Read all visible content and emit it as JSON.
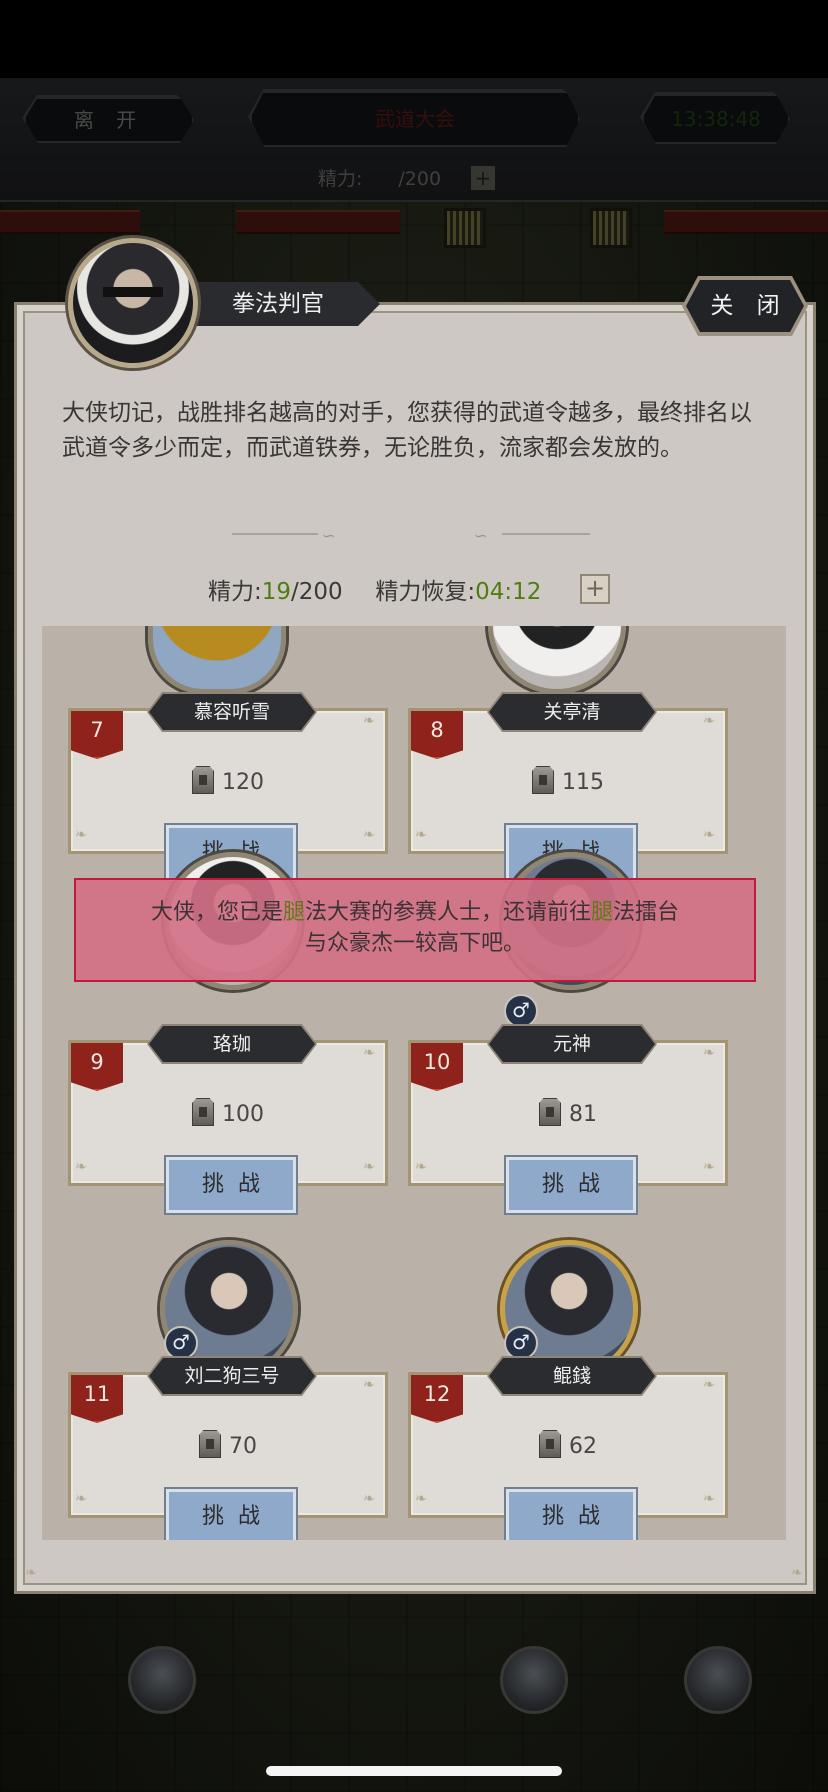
{
  "topbar": {
    "leave_label": "离 开",
    "event_title": "武道大会",
    "timer": "13:38:48",
    "energy_label": "精力:",
    "energy_value": "/200",
    "plus": "+"
  },
  "dialog": {
    "judge_name": "拳法判官",
    "close_label": "关 闭",
    "intro_text": "大侠切记，战胜排名越高的对手，您获得的武道令越多，最终排名以武道令多少而定，而武道铁券，无论胜负，流家都会发放的。",
    "energy_label": "精力:",
    "energy_current": "19",
    "energy_max": "/200",
    "recover_label": "精力恢复:",
    "recover_time": "04:12",
    "plus": "+"
  },
  "opponents": [
    {
      "rank": "7",
      "name": "慕容听雪",
      "score": "120",
      "challenge": "挑战"
    },
    {
      "rank": "8",
      "name": "关亭清",
      "score": "115",
      "challenge": "挑战"
    },
    {
      "rank": "9",
      "name": "珞珈",
      "score": "100",
      "challenge": "挑战"
    },
    {
      "rank": "10",
      "name": "元神",
      "score": "81",
      "challenge": "挑战",
      "gender": "♂"
    },
    {
      "rank": "11",
      "name": "刘二狗三号",
      "score": "70",
      "challenge": "挑战",
      "gender": "♂"
    },
    {
      "rank": "12",
      "name": "鲲錢",
      "score": "62",
      "challenge": "挑战",
      "gender": "♂"
    }
  ],
  "toast": {
    "part1": "大侠，您已是",
    "hl1": "腿",
    "part2": "法大赛的参赛人士，还请前往",
    "hl2": "腿",
    "part3": "法擂台",
    "line2": "与众豪杰一较高下吧。"
  },
  "colors": {
    "accent_green": "#4f7d14",
    "rank_red": "#8f231b",
    "button_blue": "#8fa9cb",
    "toast_pink": "#d37187"
  }
}
